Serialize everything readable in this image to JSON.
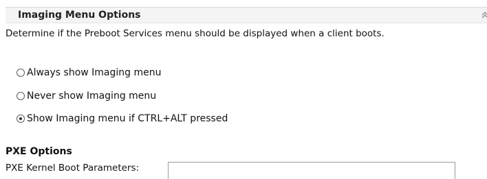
{
  "section": {
    "title": "Imaging Menu Options",
    "collapse_icon": "double-chevron-up-icon",
    "description": "Determine if the Preboot Services menu should be displayed when a client boots."
  },
  "imaging_menu": {
    "options": [
      {
        "label": "Always show Imaging menu",
        "selected": false
      },
      {
        "label": "Never show Imaging menu",
        "selected": false
      },
      {
        "label": "Show Imaging menu if CTRL+ALT pressed",
        "selected": true
      }
    ]
  },
  "pxe": {
    "title": "PXE Options",
    "kernel_label": "PXE Kernel Boot Parameters:",
    "kernel_value": ""
  }
}
